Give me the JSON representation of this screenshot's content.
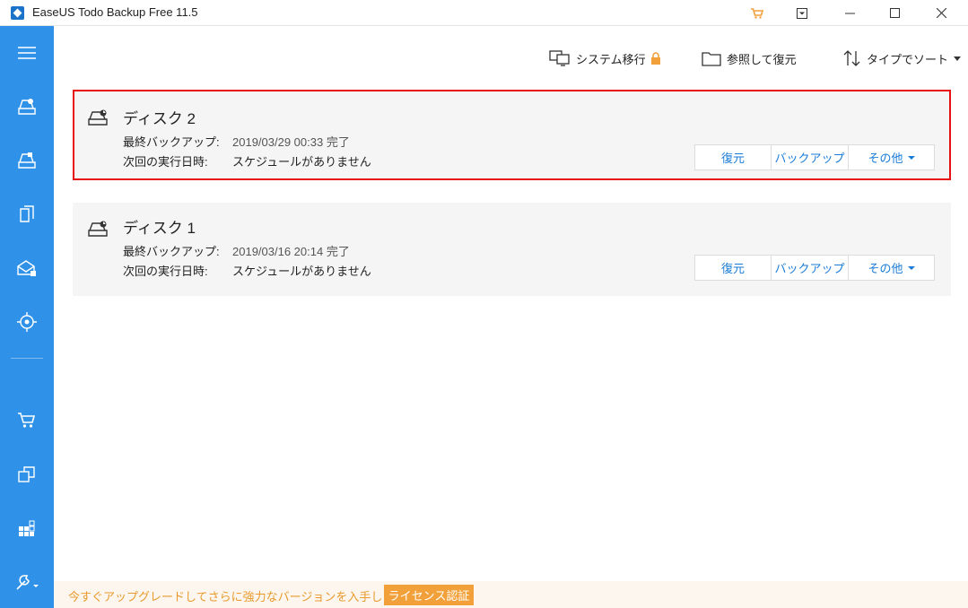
{
  "window": {
    "title": "EaseUS Todo Backup Free 11.5",
    "controls": {
      "minimize": "—",
      "maximize": "☐",
      "close": "✕"
    }
  },
  "sidebar": {
    "items": [
      {
        "icon": "hamburger-menu-icon"
      },
      {
        "icon": "disk-backup-icon"
      },
      {
        "icon": "system-backup-icon"
      },
      {
        "icon": "file-backup-icon"
      },
      {
        "icon": "mail-backup-icon"
      },
      {
        "icon": "smart-backup-icon"
      },
      {
        "icon": "cart-icon"
      },
      {
        "icon": "clone-icon"
      },
      {
        "icon": "apps-icon"
      },
      {
        "icon": "tools-icon"
      }
    ]
  },
  "toolbar": {
    "system_transfer": "システム移行",
    "browse_restore": "参照して復元",
    "sort": "タイプでソート"
  },
  "cards": [
    {
      "title": "ディスク 2",
      "last_backup_label": "最終バックアップ:",
      "last_backup_value": "2019/03/29 00:33 完了",
      "next_run_label": "次回の実行日時:",
      "next_run_value": "スケジュールがありません",
      "restore": "復元",
      "backup": "バックアップ",
      "more": "その他"
    },
    {
      "title": "ディスク 1",
      "last_backup_label": "最終バックアップ:",
      "last_backup_value": "2019/03/16 20:14 完了",
      "next_run_label": "次回の実行日時:",
      "next_run_value": "スケジュールがありません",
      "restore": "復元",
      "backup": "バックアップ",
      "more": "その他"
    }
  ],
  "bottom": {
    "upgrade_text": "今すぐアップグレードしてさらに強力なバージョンを入手しましょう。",
    "license_button": "ライセンス認証"
  },
  "colors": {
    "sidebar": "#2f92e8",
    "accent_blue": "#1a7bd6",
    "highlight_red": "#e81010",
    "orange": "#f2a03a"
  }
}
